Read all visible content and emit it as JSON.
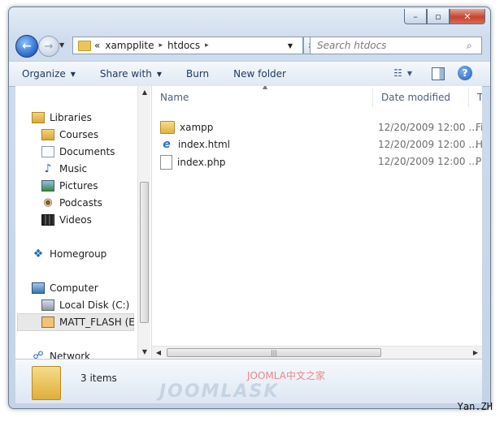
{
  "window": {
    "controls": {
      "minimize": "–",
      "maximize": "▫",
      "close": "✕"
    }
  },
  "nav": {
    "path": [
      "xampplite",
      "htdocs"
    ],
    "prefix": "«",
    "separator": "▸",
    "search_placeholder": "Search htdocs"
  },
  "toolbar": {
    "organize": "Organize",
    "share": "Share with",
    "burn": "Burn",
    "new_folder": "New folder"
  },
  "sidebar": {
    "libraries": "Libraries",
    "lib_items": [
      "Courses",
      "Documents",
      "Music",
      "Pictures",
      "Podcasts",
      "Videos"
    ],
    "homegroup": "Homegroup",
    "computer": "Computer",
    "drives": [
      "Local Disk (C:)",
      "MATT_FLASH (E:"
    ],
    "network": "Network"
  },
  "files": {
    "columns": {
      "name": "Name",
      "date": "Date modified",
      "type": "Typ"
    },
    "rows": [
      {
        "name": "xampp",
        "date": "12/20/2009 12:00 ...",
        "type": "File",
        "icon": "folder-icon"
      },
      {
        "name": "index.html",
        "date": "12/20/2009 12:00 ...",
        "type": "HTI",
        "icon": "ie-html-icon"
      },
      {
        "name": "index.php",
        "date": "12/20/2009 12:00 ...",
        "type": "PHI",
        "icon": "file-icon"
      }
    ]
  },
  "status": {
    "count": "3 items"
  },
  "watermark": {
    "line1": "JOOMLA中文之家",
    "line2": "JOOMLASK"
  },
  "signature": "Yan.ZH"
}
